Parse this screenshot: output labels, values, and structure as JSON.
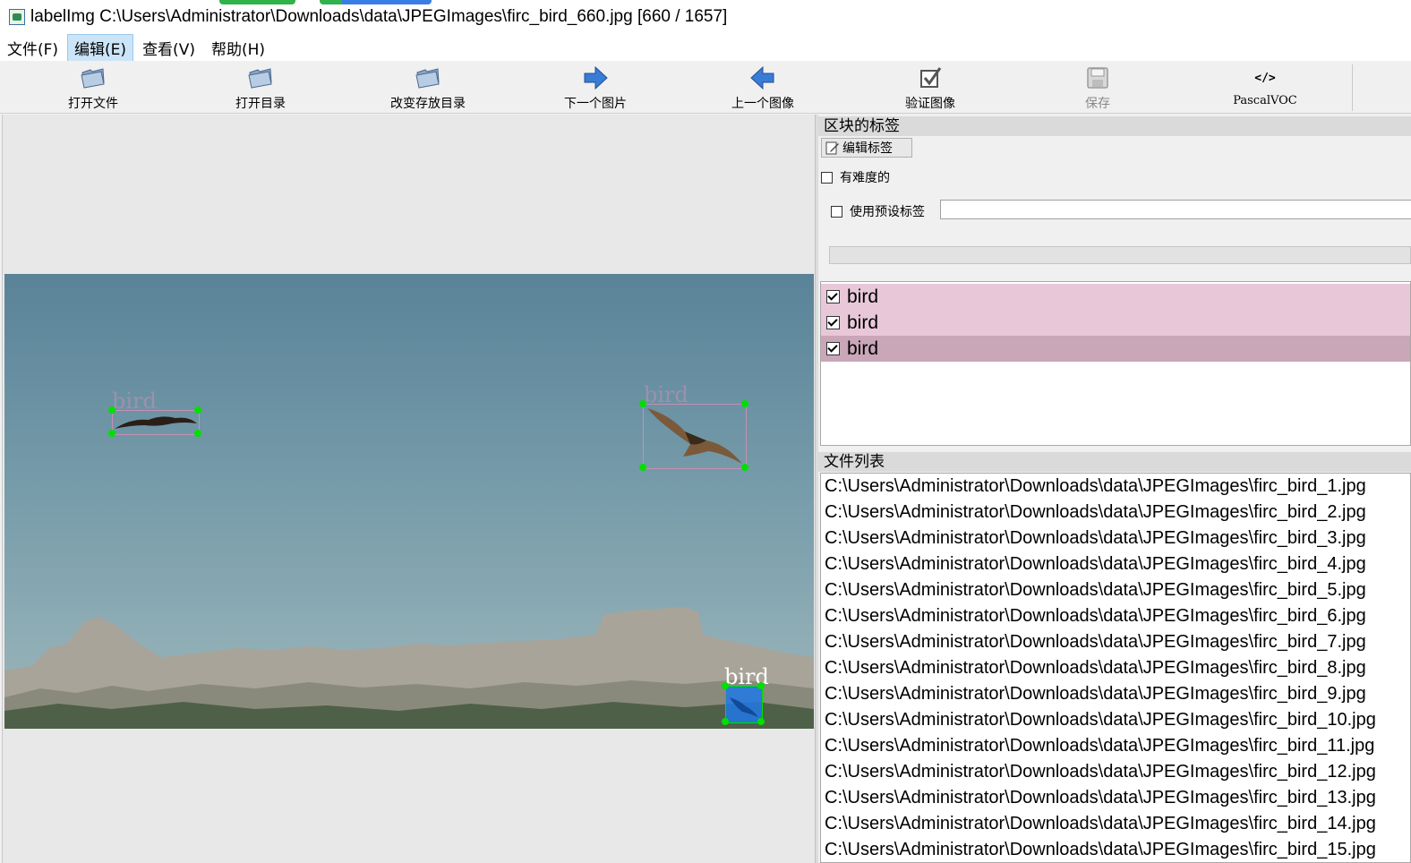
{
  "window": {
    "title": "labelImg C:\\Users\\Administrator\\Downloads\\data\\JPEGImages\\firc_bird_660.jpg [660 / 1657]"
  },
  "menu": {
    "items": [
      {
        "label": "文件(F)"
      },
      {
        "label": "编辑(E)"
      },
      {
        "label": "查看(V)"
      },
      {
        "label": "帮助(H)"
      }
    ]
  },
  "toolbar": {
    "open_file": "打开文件",
    "open_dir": "打开目录",
    "change_save_dir": "改变存放目录",
    "next_image": "下一个图片",
    "prev_image": "上一个图像",
    "verify_image": "验证图像",
    "save": "保存",
    "format": "PascalVOC",
    "format_icon_text": "</>"
  },
  "canvas": {
    "boxes": [
      {
        "label": "bird"
      },
      {
        "label": "bird"
      },
      {
        "label": "bird"
      }
    ]
  },
  "box_labels_dock": {
    "title": "区块的标签",
    "edit_label_button": "编辑标签",
    "difficult_label": "有难度的",
    "difficult_checked": false,
    "use_default_label": "使用预设标签",
    "use_default_checked": false,
    "default_label_value": "",
    "labels": [
      {
        "text": "bird",
        "checked": true,
        "color": "#e8c8d8"
      },
      {
        "text": "bird",
        "checked": true,
        "color": "#e8c8d8"
      },
      {
        "text": "bird",
        "checked": true,
        "color": "#c9a6b8"
      }
    ]
  },
  "file_list_dock": {
    "title": "文件列表",
    "files": [
      "C:\\Users\\Administrator\\Downloads\\data\\JPEGImages\\firc_bird_1.jpg",
      "C:\\Users\\Administrator\\Downloads\\data\\JPEGImages\\firc_bird_2.jpg",
      "C:\\Users\\Administrator\\Downloads\\data\\JPEGImages\\firc_bird_3.jpg",
      "C:\\Users\\Administrator\\Downloads\\data\\JPEGImages\\firc_bird_4.jpg",
      "C:\\Users\\Administrator\\Downloads\\data\\JPEGImages\\firc_bird_5.jpg",
      "C:\\Users\\Administrator\\Downloads\\data\\JPEGImages\\firc_bird_6.jpg",
      "C:\\Users\\Administrator\\Downloads\\data\\JPEGImages\\firc_bird_7.jpg",
      "C:\\Users\\Administrator\\Downloads\\data\\JPEGImages\\firc_bird_8.jpg",
      "C:\\Users\\Administrator\\Downloads\\data\\JPEGImages\\firc_bird_9.jpg",
      "C:\\Users\\Administrator\\Downloads\\data\\JPEGImages\\firc_bird_10.jpg",
      "C:\\Users\\Administrator\\Downloads\\data\\JPEGImages\\firc_bird_11.jpg",
      "C:\\Users\\Administrator\\Downloads\\data\\JPEGImages\\firc_bird_12.jpg",
      "C:\\Users\\Administrator\\Downloads\\data\\JPEGImages\\firc_bird_13.jpg",
      "C:\\Users\\Administrator\\Downloads\\data\\JPEGImages\\firc_bird_14.jpg",
      "C:\\Users\\Administrator\\Downloads\\data\\JPEGImages\\firc_bird_15.jpg"
    ]
  },
  "colors": {
    "box_outline": "#c790b2",
    "handle": "#00e000",
    "selected_fill": "#1e78e6",
    "menu_highlight": "#cce4f7"
  }
}
